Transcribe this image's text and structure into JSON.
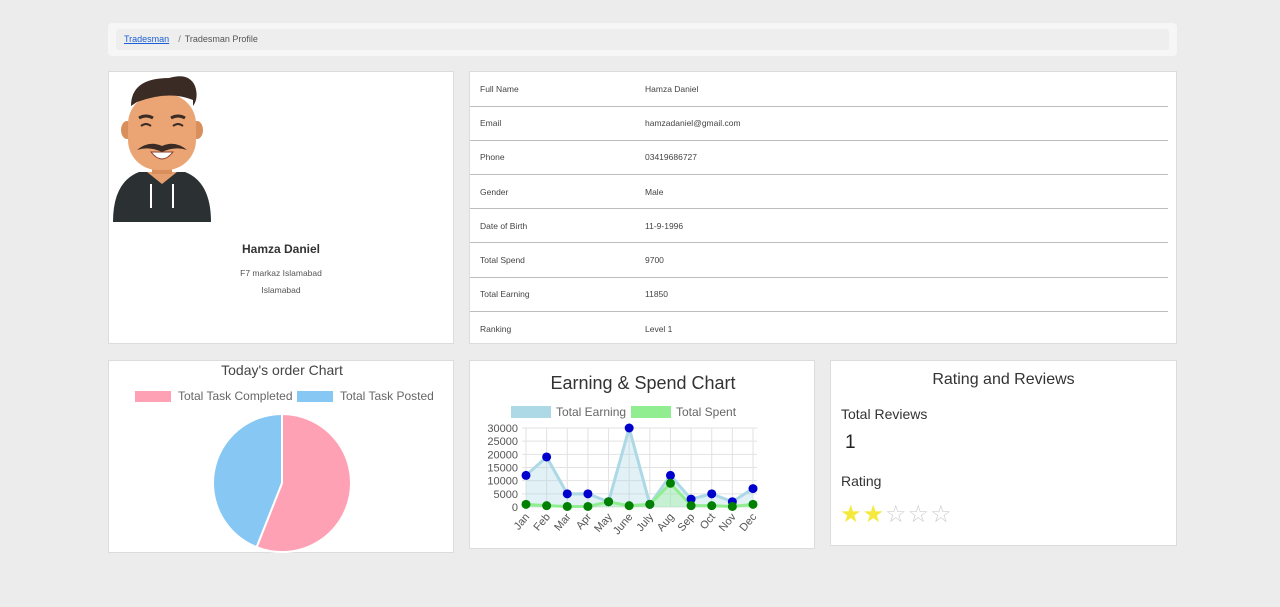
{
  "breadcrumb": {
    "link": "Tradesman",
    "current": "Tradesman Profile"
  },
  "profile": {
    "name": "Hamza Daniel",
    "address": "F7 markaz Islamabad",
    "city": "Islamabad"
  },
  "details": [
    {
      "label": "Full Name",
      "value": "Hamza Daniel"
    },
    {
      "label": "Email",
      "value": "hamzadaniel@gmail.com"
    },
    {
      "label": "Phone",
      "value": "03419686727"
    },
    {
      "label": "Gender",
      "value": "Male"
    },
    {
      "label": "Date of Birth",
      "value": "11-9-1996"
    },
    {
      "label": "Total Spend",
      "value": "9700"
    },
    {
      "label": "Total Earning",
      "value": "11850"
    },
    {
      "label": "Ranking",
      "value": "Level 1"
    }
  ],
  "ratings": {
    "title": "Rating and Reviews",
    "reviews_label": "Total Reviews",
    "reviews_count": "1",
    "rating_label": "Rating",
    "rating": 2,
    "max": 5,
    "star_on_color": "#f5e93d",
    "star_off_color": "#cfcfcf"
  },
  "chart_data": [
    {
      "type": "pie",
      "title": "Today's order Chart",
      "categories": [
        "Total Task Completed",
        "Total Task Posted"
      ],
      "values": [
        56,
        44
      ],
      "colors": [
        "#ffa1b5",
        "#86c7f3"
      ],
      "legend": "top"
    },
    {
      "type": "line",
      "title": "Earning & Spend Chart",
      "categories": [
        "Jan",
        "Feb",
        "Mar",
        "Apr",
        "May",
        "June",
        "July",
        "Aug",
        "Sep",
        "Oct",
        "Nov",
        "Dec"
      ],
      "series": [
        {
          "name": "Total Earning",
          "values": [
            12000,
            19000,
            5000,
            5000,
            2000,
            30000,
            1000,
            12000,
            3000,
            5000,
            2000,
            7000
          ],
          "color": "#add8e6",
          "point_color": "#0000cd"
        },
        {
          "name": "Total Spent",
          "values": [
            1000,
            500,
            200,
            200,
            2000,
            500,
            1000,
            9000,
            500,
            500,
            200,
            1000
          ],
          "color": "#90ee90",
          "point_color": "#008000"
        }
      ],
      "yticks": [
        "30000",
        "25000",
        "20000",
        "15000",
        "10000",
        "5000",
        "0"
      ],
      "ylim": [
        0,
        30000
      ],
      "grid": true,
      "legend": "top"
    }
  ]
}
